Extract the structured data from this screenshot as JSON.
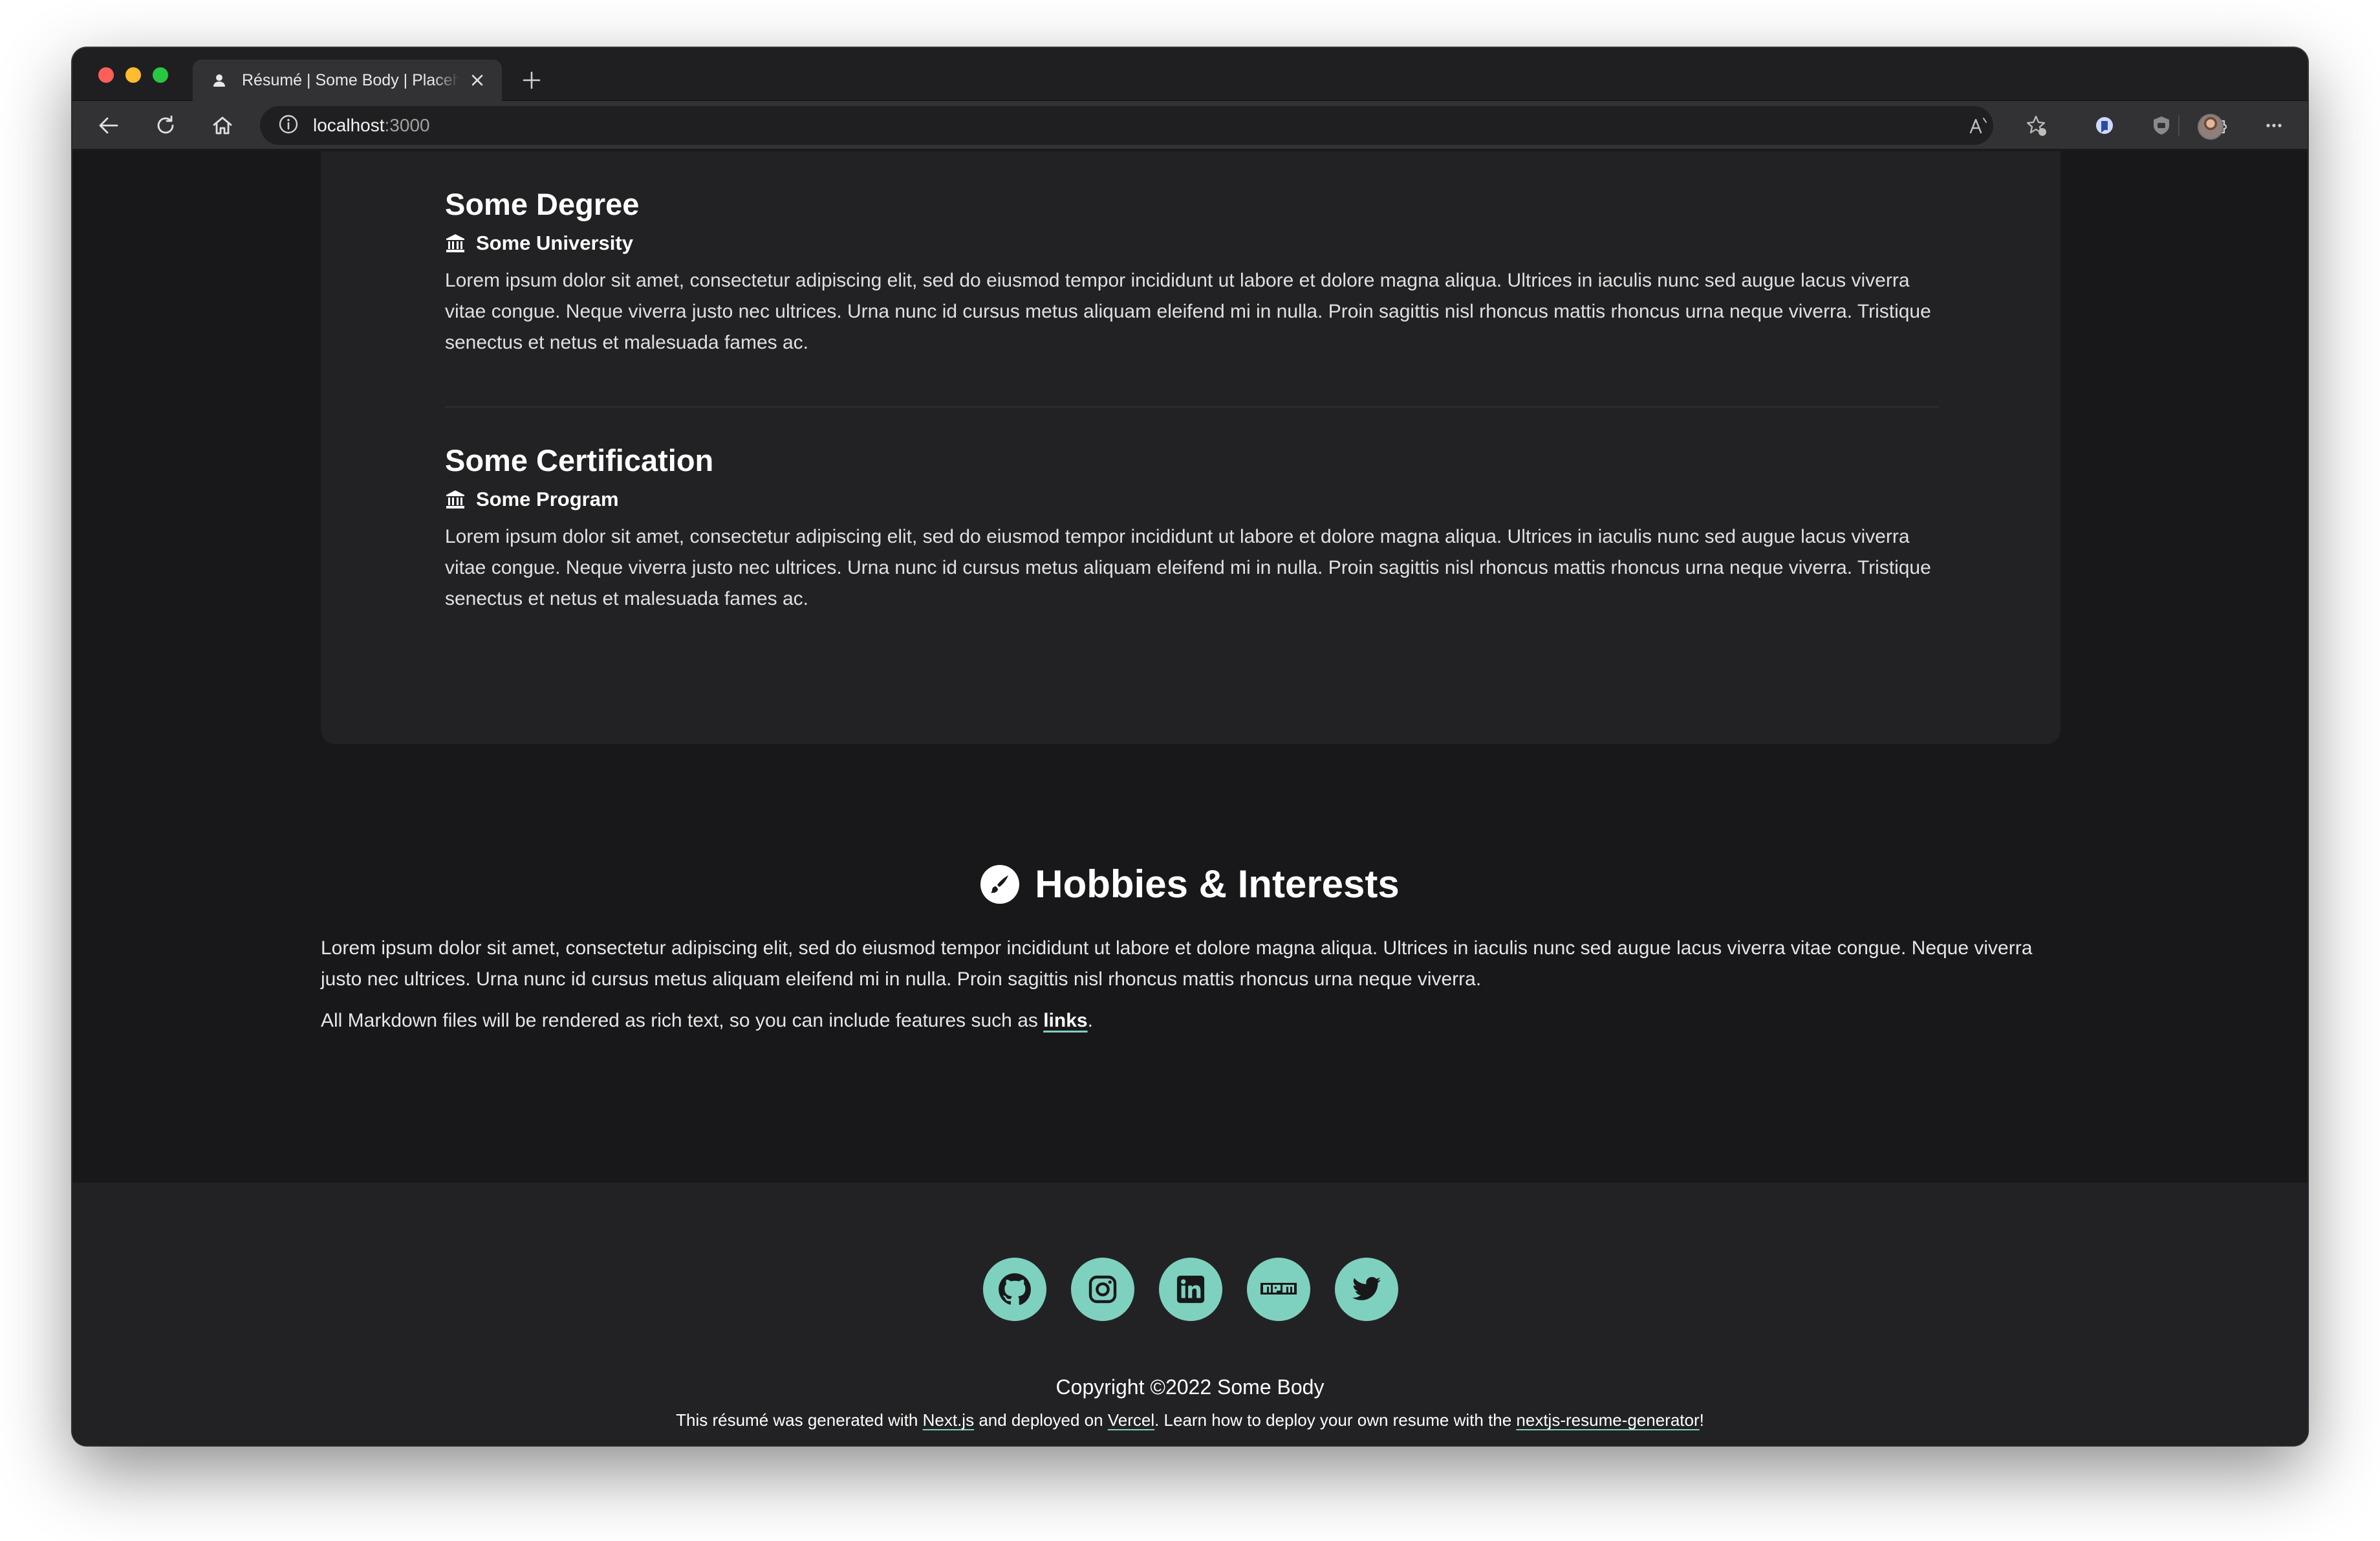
{
  "browser": {
    "tab_title": "Résumé | Some Body | Placeholder",
    "url_host": "localhost",
    "url_port": ":3000",
    "icons": [
      "back-icon",
      "reload-icon",
      "home-icon",
      "info-icon",
      "read-aloud-icon",
      "favorite-icon",
      "extension-icon",
      "shield-icon",
      "puzzle-icon",
      "more-icon"
    ]
  },
  "education": [
    {
      "title": "Some Degree",
      "institution": "Some University",
      "description": "Lorem ipsum dolor sit amet, consectetur adipiscing elit, sed do eiusmod tempor incididunt ut labore et dolore magna aliqua. Ultrices in iaculis nunc sed augue lacus viverra vitae congue. Neque viverra justo nec ultrices. Urna nunc id cursus metus aliquam eleifend mi in nulla. Proin sagittis nisl rhoncus mattis rhoncus urna neque viverra. Tristique senectus et netus et malesuada fames ac."
    },
    {
      "title": "Some Certification",
      "institution": "Some Program",
      "description": "Lorem ipsum dolor sit amet, consectetur adipiscing elit, sed do eiusmod tempor incididunt ut labore et dolore magna aliqua. Ultrices in iaculis nunc sed augue lacus viverra vitae congue. Neque viverra justo nec ultrices. Urna nunc id cursus metus aliquam eleifend mi in nulla. Proin sagittis nisl rhoncus mattis rhoncus urna neque viverra. Tristique senectus et netus et malesuada fames ac."
    }
  ],
  "hobbies": {
    "title": "Hobbies & Interests",
    "paragraph": "Lorem ipsum dolor sit amet, consectetur adipiscing elit, sed do eiusmod tempor incididunt ut labore et dolore magna aliqua. Ultrices in iaculis nunc sed augue lacus viverra vitae congue. Neque viverra justo nec ultrices. Urna nunc id cursus metus aliquam eleifend mi in nulla. Proin sagittis nisl rhoncus mattis rhoncus urna neque viverra.",
    "markdown_prefix": "All Markdown files will be rendered as rich text, so you can include features such as ",
    "markdown_link": "links",
    "markdown_suffix": "."
  },
  "footer": {
    "social_icons": [
      "github-icon",
      "instagram-icon",
      "linkedin-icon",
      "npm-icon",
      "twitter-icon"
    ],
    "copyright": "Copyright ©2022 Some Body",
    "credits_1": "This résumé was generated with ",
    "credits_link_1": "Next.js",
    "credits_2": " and deployed on ",
    "credits_link_2": "Vercel",
    "credits_3": ". Learn how to deploy your own resume with the ",
    "credits_link_3": "nextjs-resume-generator",
    "credits_4": "!"
  },
  "colors": {
    "accent": "#7fd1bf",
    "page_bg": "#18181b",
    "card_bg": "#222225"
  }
}
